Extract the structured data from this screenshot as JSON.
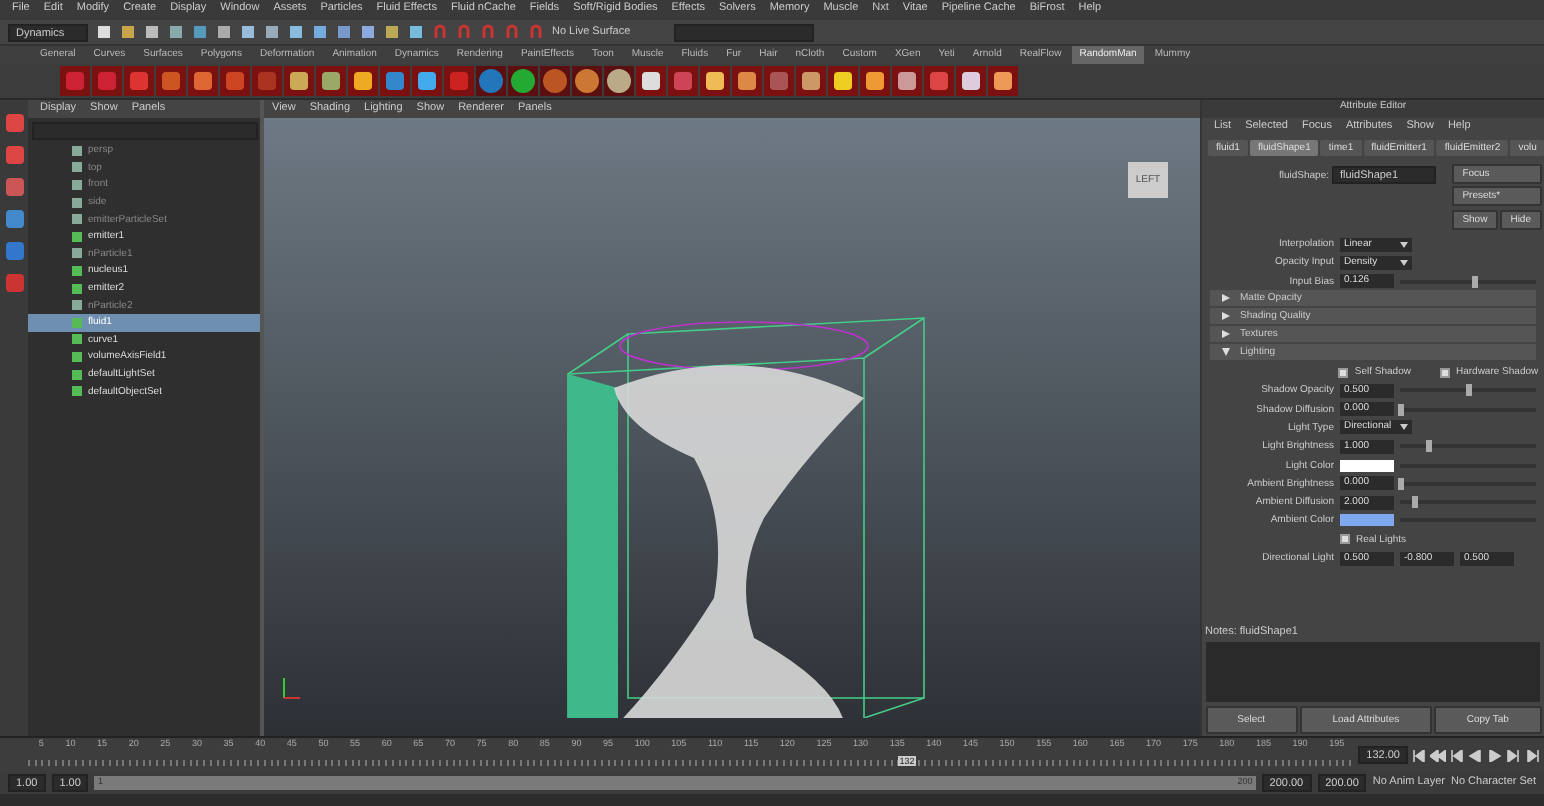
{
  "menu_bar": [
    "File",
    "Edit",
    "Modify",
    "Create",
    "Display",
    "Window",
    "Assets",
    "Particles",
    "Fluid Effects",
    "Fluid nCache",
    "Fields",
    "Soft/Rigid Bodies",
    "Effects",
    "Solvers",
    "Memory",
    "Muscle",
    "Nxt",
    "Vitae",
    "Pipeline Cache",
    "BiFrost",
    "Help"
  ],
  "status_line": {
    "mode": "Dynamics",
    "live_surface": "No Live Surface"
  },
  "shelf_tabs": [
    {
      "label": "General",
      "selected": false
    },
    {
      "label": "Curves",
      "selected": false
    },
    {
      "label": "Surfaces",
      "selected": false
    },
    {
      "label": "Polygons",
      "selected": false
    },
    {
      "label": "Deformation",
      "selected": false
    },
    {
      "label": "Animation",
      "selected": false
    },
    {
      "label": "Dynamics",
      "selected": false
    },
    {
      "label": "Rendering",
      "selected": false
    },
    {
      "label": "PaintEffects",
      "selected": false
    },
    {
      "label": "Toon",
      "selected": false
    },
    {
      "label": "Muscle",
      "selected": false
    },
    {
      "label": "Fluids",
      "selected": false
    },
    {
      "label": "Fur",
      "selected": false
    },
    {
      "label": "Hair",
      "selected": false
    },
    {
      "label": "nCloth",
      "selected": false
    },
    {
      "label": "Custom",
      "selected": false
    },
    {
      "label": "XGen",
      "selected": false
    },
    {
      "label": "Yeti",
      "selected": false
    },
    {
      "label": "Arnold",
      "selected": false
    },
    {
      "label": "RealFlow",
      "selected": false
    },
    {
      "label": "RandomMan",
      "selected": true
    },
    {
      "label": "Mummy",
      "selected": false
    }
  ],
  "outliner": {
    "menu": [
      "Display",
      "Show",
      "Panels"
    ],
    "items": [
      {
        "label": "persp",
        "dim": true,
        "selected": false
      },
      {
        "label": "top",
        "dim": true,
        "selected": false
      },
      {
        "label": "front",
        "dim": true,
        "selected": false
      },
      {
        "label": "side",
        "dim": true,
        "selected": false
      },
      {
        "label": "emitterParticleSet",
        "dim": true,
        "selected": false
      },
      {
        "label": "emitter1",
        "dim": false,
        "selected": false
      },
      {
        "label": "nParticle1",
        "dim": true,
        "selected": false
      },
      {
        "label": "nucleus1",
        "dim": false,
        "selected": false
      },
      {
        "label": "emitter2",
        "dim": false,
        "selected": false
      },
      {
        "label": "nParticle2",
        "dim": true,
        "selected": false
      },
      {
        "label": "fluid1",
        "dim": false,
        "selected": true
      },
      {
        "label": "curve1",
        "dim": false,
        "selected": false
      },
      {
        "label": "volumeAxisField1",
        "dim": false,
        "selected": false
      },
      {
        "label": "defaultLightSet",
        "dim": false,
        "selected": false
      },
      {
        "label": "defaultObjectSet",
        "dim": false,
        "selected": false
      }
    ]
  },
  "viewport": {
    "menu": [
      "View",
      "Shading",
      "Lighting",
      "Show",
      "Renderer",
      "Panels"
    ],
    "view_cube": "LEFT"
  },
  "attribute_editor": {
    "title": "Attribute Editor",
    "menu": [
      "List",
      "Selected",
      "Focus",
      "Attributes",
      "Show",
      "Help"
    ],
    "tabs": [
      {
        "label": "fluid1",
        "selected": false
      },
      {
        "label": "fluidShape1",
        "selected": true
      },
      {
        "label": "time1",
        "selected": false
      },
      {
        "label": "fluidEmitter1",
        "selected": false
      },
      {
        "label": "fluidEmitter2",
        "selected": false
      },
      {
        "label": "volu",
        "selected": false
      }
    ],
    "node_label": "fluidShape:",
    "node_name": "fluidShape1",
    "buttons": [
      "Focus",
      "Presets*",
      "Show",
      "Hide"
    ],
    "rows": [
      {
        "kind": "dropdown",
        "label": "Interpolation",
        "value": "Linear"
      },
      {
        "kind": "dropdown",
        "label": "Opacity Input",
        "value": "Density"
      },
      {
        "kind": "number",
        "label": "Input Bias",
        "value": "0.126",
        "level": 0.55
      },
      {
        "kind": "section",
        "label": "Matte Opacity",
        "expanded": false
      },
      {
        "kind": "section",
        "label": "Shading Quality",
        "expanded": false
      },
      {
        "kind": "section",
        "label": "Textures",
        "expanded": false
      },
      {
        "kind": "section",
        "label": "Lighting",
        "expanded": true
      },
      {
        "kind": "checkpair",
        "label": "Self Shadow",
        "checked": true,
        "label2": "Hardware Shadow",
        "checked2": true
      },
      {
        "kind": "number",
        "label": "Shadow Opacity",
        "value": "0.500",
        "level": 0.5
      },
      {
        "kind": "number",
        "label": "Shadow Diffusion",
        "value": "0.000",
        "level": 0.0
      },
      {
        "kind": "dropdown",
        "label": "Light Type",
        "value": "Directional"
      },
      {
        "kind": "number",
        "label": "Light Brightness",
        "value": "1.000",
        "level": 0.2
      },
      {
        "kind": "color",
        "label": "Light Color",
        "color": "#ffffff"
      },
      {
        "kind": "number",
        "label": "Ambient Brightness",
        "value": "0.000",
        "level": 0.0
      },
      {
        "kind": "number",
        "label": "Ambient Diffusion",
        "value": "2.000",
        "level": 0.1
      },
      {
        "kind": "color",
        "label": "Ambient Color",
        "color": "#80a8f0"
      },
      {
        "kind": "checkbox",
        "label": "Real Lights",
        "checked": true
      },
      {
        "kind": "vector",
        "label": "Directional Light",
        "values": [
          "0.500",
          "-0.800",
          "0.500"
        ]
      }
    ],
    "notes_label": "Notes:",
    "notes_node": "fluidShape1",
    "bottom_buttons": [
      "Select",
      "Load Attributes",
      "Copy Tab"
    ]
  },
  "timeline": {
    "ticks": [
      "5",
      "10",
      "15",
      "20",
      "25",
      "30",
      "35",
      "40",
      "45",
      "50",
      "55",
      "60",
      "65",
      "70",
      "75",
      "80",
      "85",
      "90",
      "95",
      "100",
      "105",
      "110",
      "115",
      "120",
      "125",
      "130",
      "135",
      "140",
      "145",
      "150",
      "155",
      "160",
      "165",
      "170",
      "175",
      "180",
      "185",
      "190",
      "195"
    ],
    "current_frame": "132",
    "current_field": "132.00",
    "level": 0.655
  },
  "range": {
    "level": 1,
    "start": "1.00",
    "playback_start": "1.00",
    "range_start": "1",
    "range_end": "200",
    "playback_end": "200.00",
    "end": "200.00",
    "anim_layer": "No Anim Layer",
    "character_set": "No Character Set"
  }
}
